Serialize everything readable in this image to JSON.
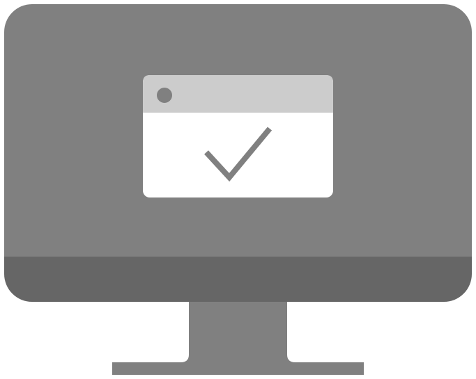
{
  "illustration": {
    "subject": "monitor-icon",
    "colors": {
      "screen": "#808080",
      "bezel": "#666666",
      "stand": "#808080",
      "window_body": "#ffffff",
      "window_titlebar": "#cccccc",
      "window_dot": "#808080",
      "checkmark": "#808080"
    },
    "icons": {
      "window": "app-window-icon",
      "status": "checkmark-icon"
    }
  }
}
